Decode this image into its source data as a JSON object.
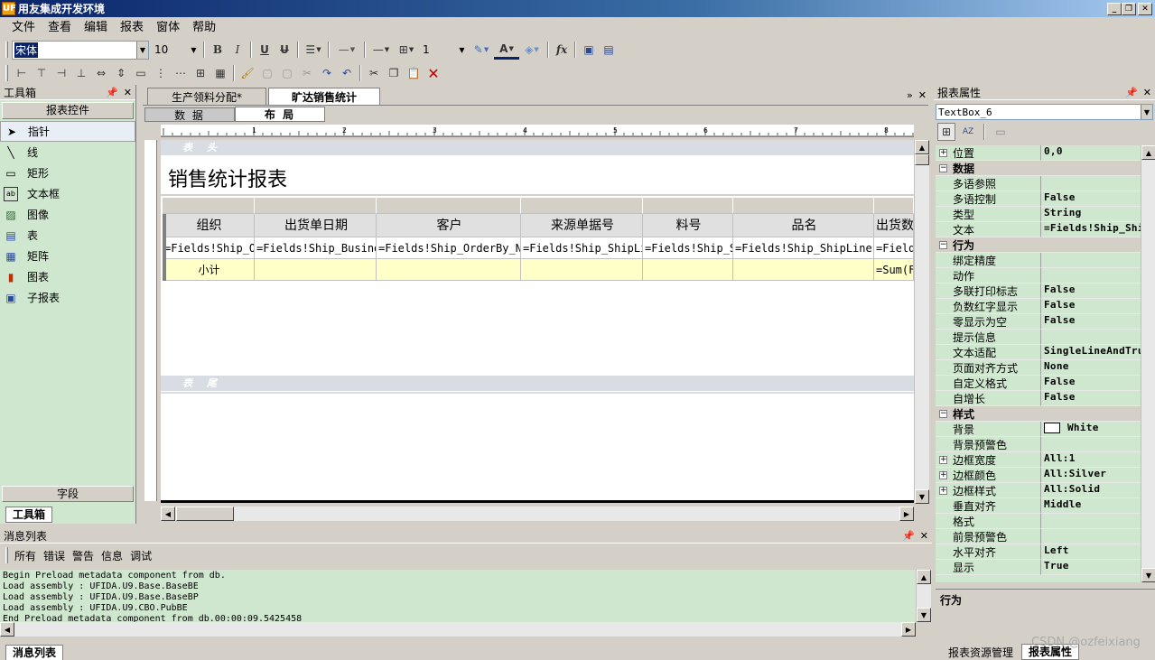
{
  "window": {
    "title": "用友集成开发环境",
    "app_icon": "UF"
  },
  "menu": [
    "文件",
    "查看",
    "编辑",
    "报表",
    "窗体",
    "帮助"
  ],
  "format_toolbar": {
    "font_name": "宋体",
    "font_size": "10",
    "line_width": "1"
  },
  "toolbox": {
    "title": "工具箱",
    "category": "报表控件",
    "items": [
      "指针",
      "线",
      "矩形",
      "文本框",
      "图像",
      "表",
      "矩阵",
      "图表",
      "子报表"
    ],
    "bottom_tabs": {
      "fields": "字段",
      "toolbox": "工具箱"
    }
  },
  "document": {
    "tabs": [
      "生产领料分配*",
      "旷达销售统计"
    ],
    "view_tabs": [
      "数 据",
      "布 局"
    ],
    "band_header": "表 头",
    "band_footer": "表 尾",
    "report_title": "销售统计报表",
    "table": {
      "headers": [
        "组织",
        "出货单日期",
        "客户",
        "来源单据号",
        "料号",
        "品名",
        "出货数"
      ],
      "detail": [
        "=Fields!Ship_Org",
        "=Fields!Ship_BusinessDate",
        "=Fields!Ship_OrderBy_Name",
        "=Fields!Ship_ShipLine",
        "=Fields!Ship_ShipLine_ItemCode",
        "=Fields!Ship_ShipLines_ItemName",
        "=Fields!Ship_Qty"
      ],
      "subtotal": [
        "小计",
        "",
        "",
        "",
        "",
        "",
        "=Sum(Fields!Ship_Qty)"
      ]
    }
  },
  "properties": {
    "title": "报表属性",
    "selected_object": "TextBox_6",
    "rows": [
      {
        "type": "prop",
        "name": "位置",
        "value": "0,0",
        "expandable": true
      },
      {
        "type": "cat",
        "name": "数据"
      },
      {
        "type": "prop",
        "name": "多语参照",
        "value": ""
      },
      {
        "type": "prop",
        "name": "多语控制",
        "value": "False"
      },
      {
        "type": "prop",
        "name": "类型",
        "value": "String"
      },
      {
        "type": "prop",
        "name": "文本",
        "value": "=Fields!Ship_ShipLines_ItemName"
      },
      {
        "type": "cat",
        "name": "行为"
      },
      {
        "type": "prop",
        "name": "绑定精度",
        "value": ""
      },
      {
        "type": "prop",
        "name": "动作",
        "value": ""
      },
      {
        "type": "prop",
        "name": "多联打印标志",
        "value": "False"
      },
      {
        "type": "prop",
        "name": "负数红字显示",
        "value": "False"
      },
      {
        "type": "prop",
        "name": "零显示为空",
        "value": "False"
      },
      {
        "type": "prop",
        "name": "提示信息",
        "value": ""
      },
      {
        "type": "prop",
        "name": "文本适配",
        "value": "SingleLineAndTruncate"
      },
      {
        "type": "prop",
        "name": "页面对齐方式",
        "value": "None"
      },
      {
        "type": "prop",
        "name": "自定义格式",
        "value": "False"
      },
      {
        "type": "prop",
        "name": "自增长",
        "value": "False"
      },
      {
        "type": "cat",
        "name": "样式"
      },
      {
        "type": "prop",
        "name": "背景",
        "value": "White",
        "swatch": true
      },
      {
        "type": "prop",
        "name": "背景预警色",
        "value": ""
      },
      {
        "type": "prop",
        "name": "边框宽度",
        "value": "All:1",
        "expandable": true
      },
      {
        "type": "prop",
        "name": "边框颜色",
        "value": "All:Silver",
        "expandable": true
      },
      {
        "type": "prop",
        "name": "边框样式",
        "value": "All:Solid",
        "expandable": true
      },
      {
        "type": "prop",
        "name": "垂直对齐",
        "value": "Middle"
      },
      {
        "type": "prop",
        "name": "格式",
        "value": ""
      },
      {
        "type": "prop",
        "name": "前景预警色",
        "value": ""
      },
      {
        "type": "prop",
        "name": "水平对齐",
        "value": "Left"
      },
      {
        "type": "prop",
        "name": "显示",
        "value": "True"
      }
    ],
    "description_title": "行为",
    "bottom_tabs": [
      "报表资源管理",
      "报表属性"
    ]
  },
  "messages": {
    "title": "消息列表",
    "filters": [
      "所有",
      "错误",
      "警告",
      "信息",
      "调试"
    ],
    "lines": [
      "Begin Preload metadata component from db.",
      "Load assembly : UFIDA.U9.Base.BaseBE",
      "Load assembly : UFIDA.U9.Base.BaseBP",
      "Load assembly : UFIDA.U9.CBO.PubBE",
      "End Preload metadata component from db.00:00:09.5425458"
    ],
    "bottom_tab": "消息列表"
  },
  "watermark": "CSDN @ozfeixiang"
}
